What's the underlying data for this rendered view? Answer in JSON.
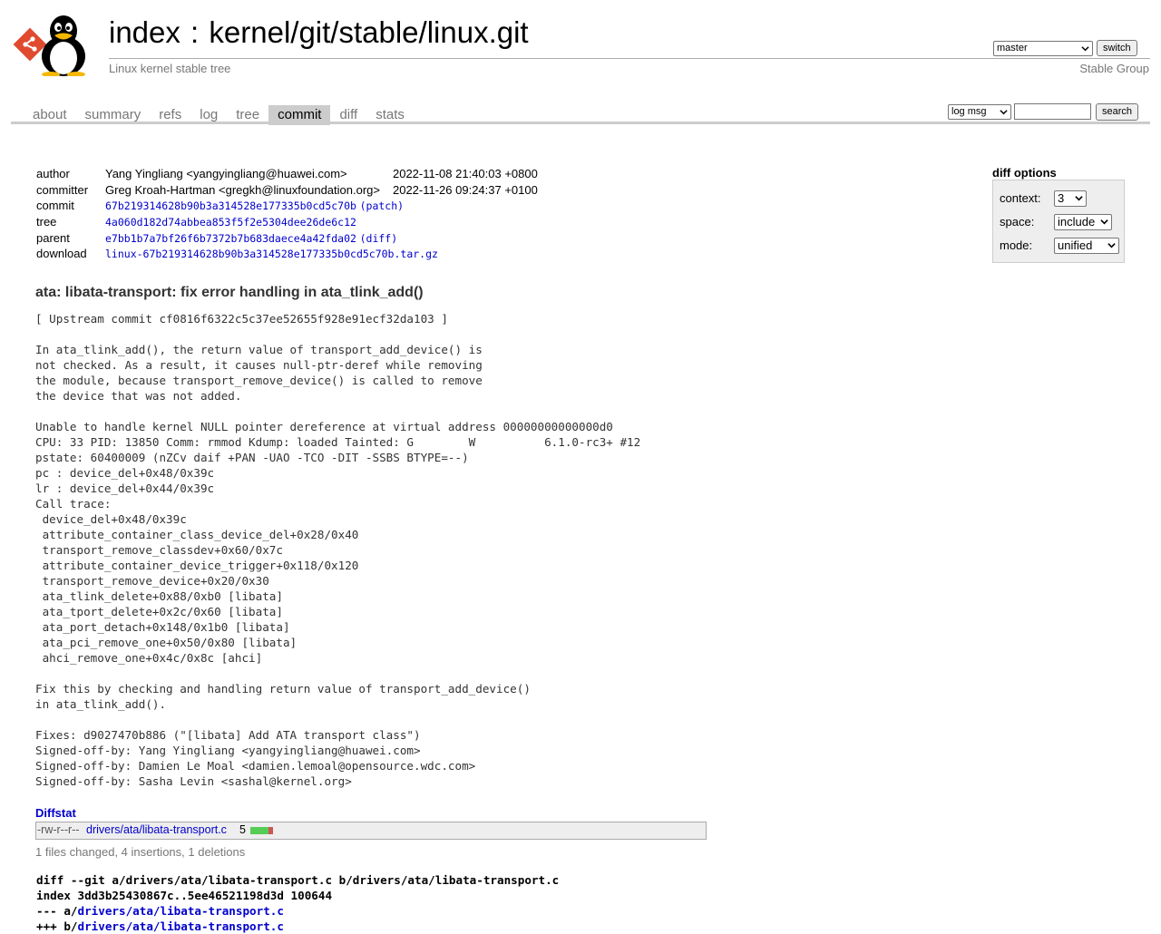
{
  "header": {
    "title_index": "index",
    "title_sep": " : ",
    "title_repo": "kernel/git/stable/linux.git",
    "description": "Linux kernel stable tree",
    "owner": "Stable Group",
    "branch": "master",
    "switch_label": "switch"
  },
  "tabs": [
    {
      "label": "about"
    },
    {
      "label": "summary"
    },
    {
      "label": "refs"
    },
    {
      "label": "log"
    },
    {
      "label": "tree"
    },
    {
      "label": "commit",
      "active": true
    },
    {
      "label": "diff"
    },
    {
      "label": "stats"
    }
  ],
  "search": {
    "mode": "log msg",
    "button": "search"
  },
  "commit_info": {
    "author_label": "author",
    "author": "Yang Yingliang <yangyingliang@huawei.com>",
    "author_date": "2022-11-08 21:40:03 +0800",
    "committer_label": "committer",
    "committer": "Greg Kroah-Hartman <gregkh@linuxfoundation.org>",
    "committer_date": "2022-11-26 09:24:37 +0100",
    "commit_label": "commit",
    "commit": "67b219314628b90b3a314528e177335b0cd5c70b",
    "patch_label": "patch",
    "tree_label": "tree",
    "tree": "4a060d182d74abbea853f5f2e5304dee26de6c12",
    "parent_label": "parent",
    "parent": "e7bb1b7a7bf26f6b7372b7b683daece4a42fda02",
    "diff_label": "diff",
    "download_label": "download",
    "download": "linux-67b219314628b90b3a314528e177335b0cd5c70b.tar.gz"
  },
  "diff_options": {
    "title": "diff options",
    "context_label": "context:",
    "context_value": "3",
    "space_label": "space:",
    "space_value": "include",
    "mode_label": "mode:",
    "mode_value": "unified"
  },
  "subject": "ata: libata-transport: fix error handling in ata_tlink_add()",
  "message": "[ Upstream commit cf0816f6322c5c37ee52655f928e91ecf32da103 ]\n\nIn ata_tlink_add(), the return value of transport_add_device() is\nnot checked. As a result, it causes null-ptr-deref while removing\nthe module, because transport_remove_device() is called to remove\nthe device that was not added.\n\nUnable to handle kernel NULL pointer dereference at virtual address 00000000000000d0\nCPU: 33 PID: 13850 Comm: rmmod Kdump: loaded Tainted: G        W          6.1.0-rc3+ #12\npstate: 60400009 (nZCv daif +PAN -UAO -TCO -DIT -SSBS BTYPE=--)\npc : device_del+0x48/0x39c\nlr : device_del+0x44/0x39c\nCall trace:\n device_del+0x48/0x39c\n attribute_container_class_device_del+0x28/0x40\n transport_remove_classdev+0x60/0x7c\n attribute_container_device_trigger+0x118/0x120\n transport_remove_device+0x20/0x30\n ata_tlink_delete+0x88/0xb0 [libata]\n ata_tport_delete+0x2c/0x60 [libata]\n ata_port_detach+0x148/0x1b0 [libata]\n ata_pci_remove_one+0x50/0x80 [libata]\n ahci_remove_one+0x4c/0x8c [ahci]\n\nFix this by checking and handling return value of transport_add_device()\nin ata_tlink_add().\n\nFixes: d9027470b886 (\"[libata] Add ATA transport class\")\nSigned-off-by: Yang Yingliang <yangyingliang@huawei.com>\nSigned-off-by: Damien Le Moal <damien.lemoal@opensource.wdc.com>\nSigned-off-by: Sasha Levin <sashal@kernel.org>",
  "diffstat": {
    "title": "Diffstat",
    "mode": "-rw-r--r--",
    "file": "drivers/ata/libata-transport.c",
    "changes": "5",
    "insertions": 4,
    "deletions": 1,
    "summary": "1 files changed, 4 insertions, 1 deletions"
  },
  "diff": {
    "git_line": "diff --git a/drivers/ata/libata-transport.c b/drivers/ata/libata-transport.c",
    "index_line": "index 3dd3b25430867c..5ee46521198d3d 100644",
    "minus_prefix": "--- a/",
    "plus_prefix": "+++ b/",
    "file": "drivers/ata/libata-transport.c"
  },
  "colors": {
    "link": "#0000cc",
    "muted": "#777777",
    "tab_active_bg": "#cccccc",
    "bar_add": "#55cc55",
    "bar_del": "#cc5555"
  }
}
